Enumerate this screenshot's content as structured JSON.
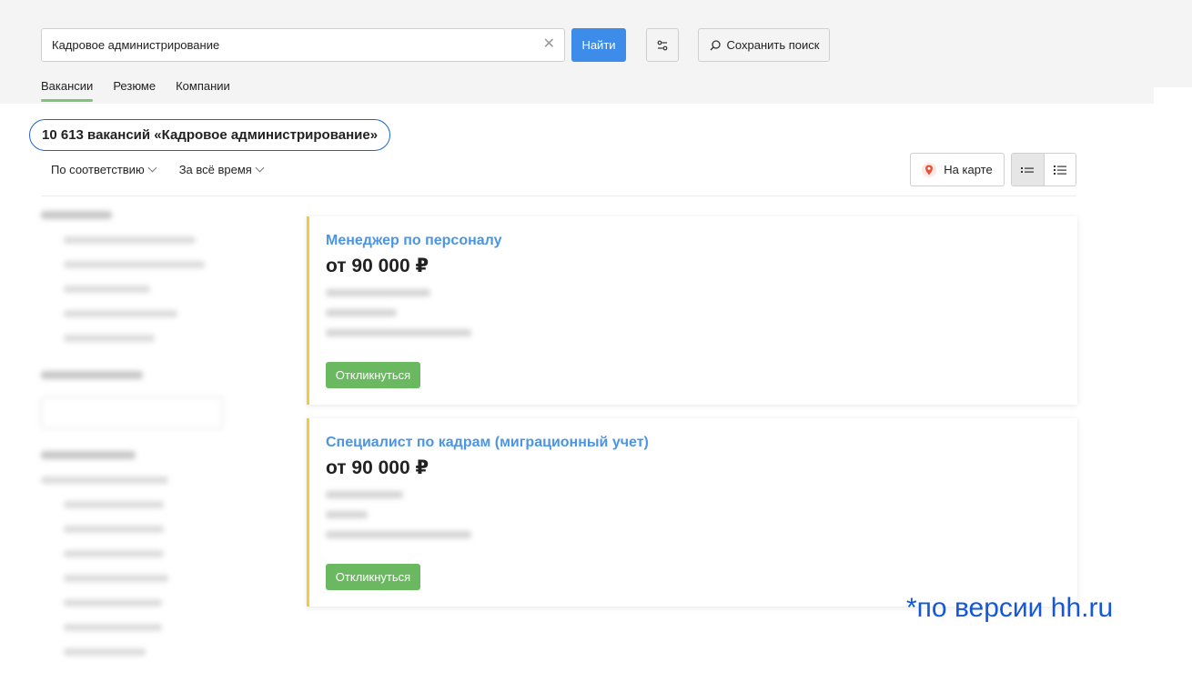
{
  "search": {
    "value": "Кадровое администрирование",
    "find_label": "Найти",
    "save_label": "Сохранить поиск"
  },
  "tabs": [
    {
      "label": "Вакансии"
    },
    {
      "label": "Резюме"
    },
    {
      "label": "Компании"
    }
  ],
  "results": {
    "title": "10 613 вакансий «Кадровое администрирование»"
  },
  "sort": {
    "relevance": "По соответствию",
    "period": "За всё время"
  },
  "view": {
    "map_label": "На карте"
  },
  "vacancies": [
    {
      "title": "Менеджер по персоналу",
      "salary": "от 90 000 ₽",
      "apply_label": "Откликнуться"
    },
    {
      "title": "Специалист по кадрам (миграционный учет)",
      "salary": "от 90 000 ₽",
      "apply_label": "Откликнуться"
    }
  ],
  "footnote": "*по версии hh.ru",
  "colors": {
    "accent": "#3d8cea",
    "apply": "#6ab85f",
    "title_link": "#4b95e3",
    "highlight": "#1e63d6",
    "card_border": "#f5c842"
  }
}
